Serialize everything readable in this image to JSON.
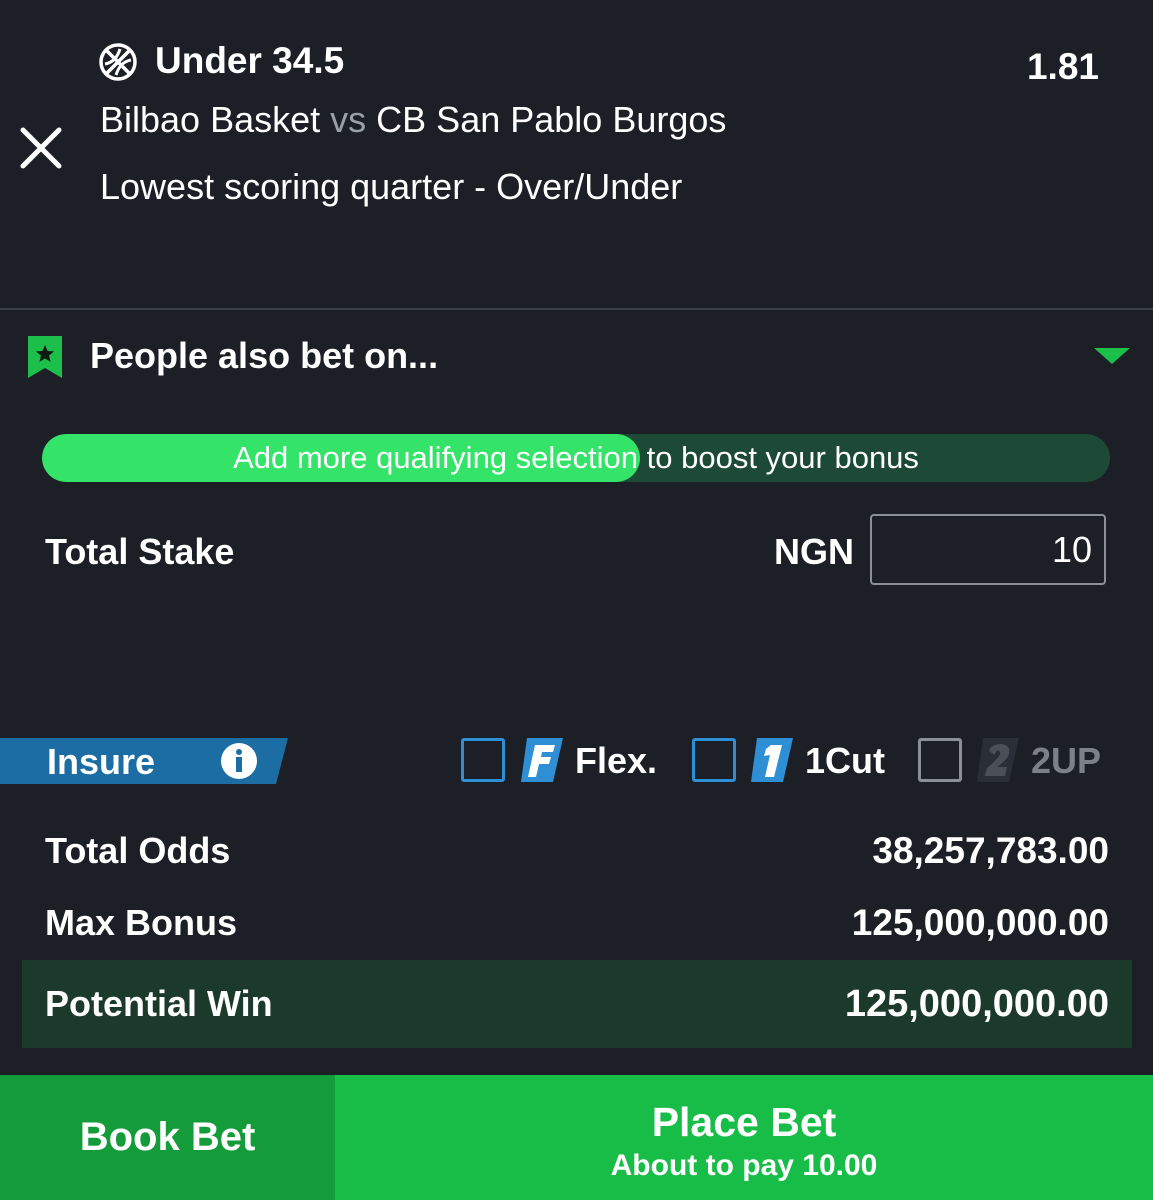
{
  "selection": {
    "sport_icon": "basketball-icon",
    "pick": "Under 34.5",
    "odds": "1.81",
    "home_team": "Bilbao Basket",
    "vs": "vs",
    "away_team": "CB San Pablo Burgos",
    "market": "Lowest scoring quarter - Over/Under"
  },
  "people_also_bet": {
    "label": "People also bet on...",
    "icon": "bookmark-star-icon"
  },
  "bonus_progress": {
    "text": "Add more qualifying selection to boost your bonus",
    "fill_fraction": 0.56
  },
  "stake": {
    "label": "Total Stake",
    "currency": "NGN",
    "value": "10"
  },
  "options": {
    "insure_label": "Insure",
    "flex_label": "Flex.",
    "onecut_label": "1Cut",
    "twoup_label": "2UP"
  },
  "summary": {
    "total_odds_label": "Total Odds",
    "total_odds_value": "38,257,783.00",
    "max_bonus_label": "Max Bonus",
    "max_bonus_value": "125,000,000.00",
    "potential_win_label": "Potential Win",
    "potential_win_value": "125,000,000.00"
  },
  "actions": {
    "book_bet_label": "Book Bet",
    "place_bet_label": "Place Bet",
    "place_bet_sub": "About to pay 10.00"
  },
  "colors": {
    "background": "#1c1f26",
    "accent_green": "#33e468",
    "place_green": "#18bd48",
    "book_green": "#149c3b",
    "insure_blue": "#1b6da3",
    "checkbox_blue": "#2f8fd5"
  }
}
